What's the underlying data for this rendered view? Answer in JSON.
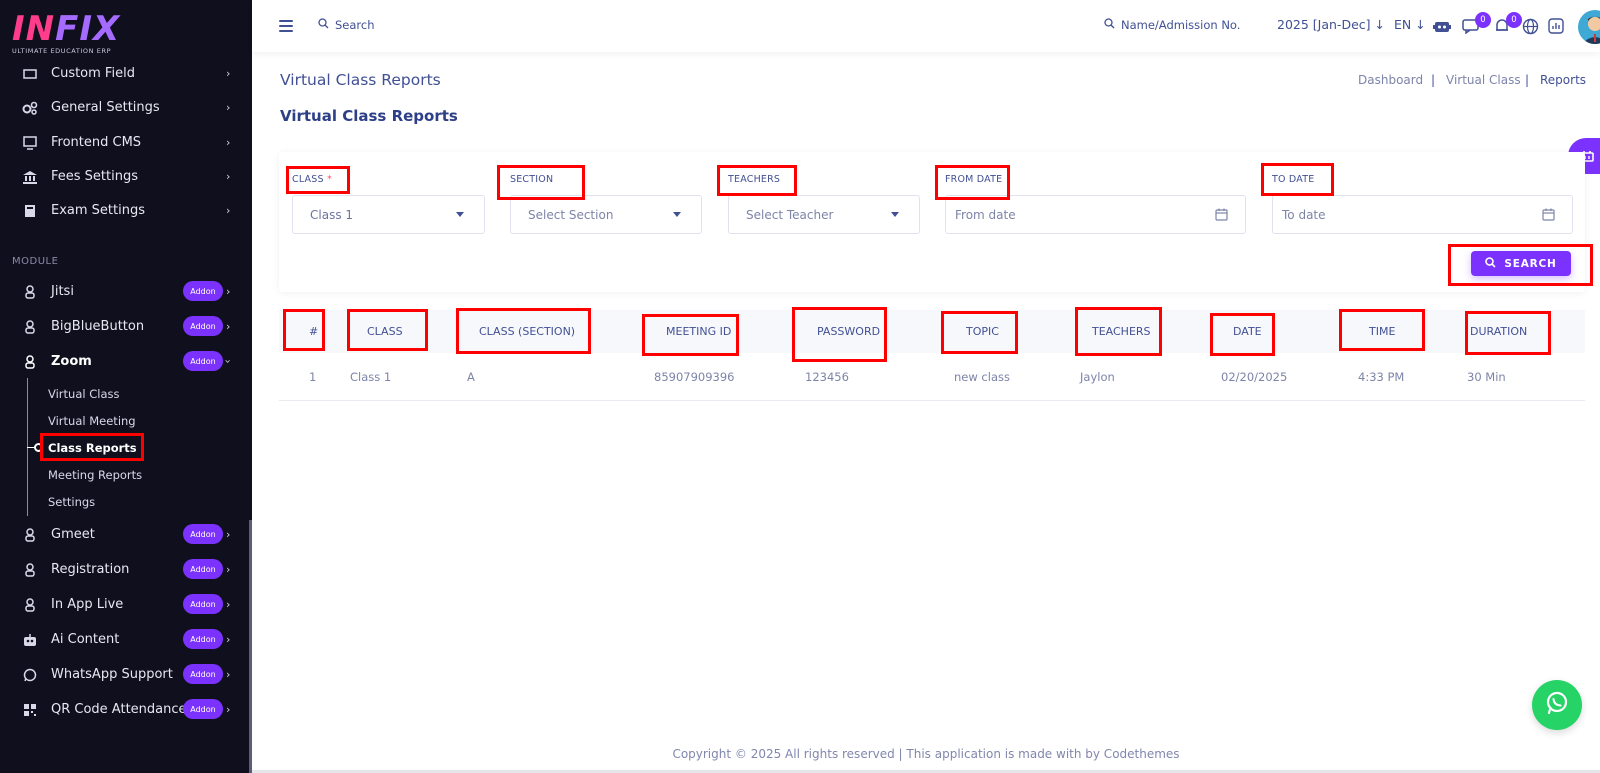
{
  "sidebar": {
    "logo_text_a": "IN",
    "logo_text_b": "FIX",
    "logo_tagline": "ULTIMATE EDUCATION ERP",
    "items_top": [
      {
        "label": "Custom Field"
      },
      {
        "label": "General Settings"
      },
      {
        "label": "Frontend CMS"
      },
      {
        "label": "Fees Settings"
      },
      {
        "label": "Exam Settings"
      }
    ],
    "module_label": "MODULE",
    "modules": [
      {
        "label": "Jitsi",
        "addon": "Addon"
      },
      {
        "label": "BigBlueButton",
        "addon": "Addon"
      },
      {
        "label": "Zoom",
        "addon": "Addon"
      },
      {
        "label": "Gmeet",
        "addon": "Addon"
      },
      {
        "label": "Registration",
        "addon": "Addon"
      },
      {
        "label": "In App Live",
        "addon": "Addon"
      },
      {
        "label": "Ai Content",
        "addon": "Addon"
      },
      {
        "label": "WhatsApp Support",
        "addon": "Addon"
      },
      {
        "label": "QR Code Attendance",
        "addon": "Addon"
      }
    ],
    "zoom_sub": [
      {
        "label": "Virtual Class"
      },
      {
        "label": "Virtual Meeting"
      },
      {
        "label": "Class Reports"
      },
      {
        "label": "Meeting Reports"
      },
      {
        "label": "Settings"
      }
    ]
  },
  "header": {
    "search_label": "Search",
    "student_search_label": "Name/Admission No.",
    "session": "2025 [Jan-Dec]",
    "language": "EN",
    "messages_count": "0",
    "notifications_count": "0"
  },
  "page": {
    "title": "Virtual Class Reports",
    "breadcrumb": [
      "Dashboard",
      "Virtual Class",
      "Reports"
    ],
    "section_title": "Virtual Class Reports"
  },
  "filters": {
    "class_label": "CLASS",
    "class_required": "*",
    "class_value": "Class 1",
    "section_label": "SECTION",
    "section_placeholder": "Select Section",
    "teachers_label": "TEACHERS",
    "teachers_placeholder": "Select Teacher",
    "from_date_label": "FROM DATE",
    "from_date_placeholder": "From date",
    "to_date_label": "TO DATE",
    "to_date_placeholder": "To date",
    "search_button": "SEARCH"
  },
  "table": {
    "columns": [
      "#",
      "CLASS",
      "CLASS (SECTION)",
      "MEETING ID",
      "PASSWORD",
      "TOPIC",
      "TEACHERS",
      "DATE",
      "TIME",
      "DURATION"
    ],
    "rows": [
      [
        "1",
        "Class 1",
        "A",
        "85907909396",
        "123456",
        "new class",
        "Jaylon",
        "02/20/2025",
        "4:33 PM",
        "30 Min"
      ]
    ]
  },
  "footer": {
    "text": "Copyright © 2025 All rights reserved | This application is made with by Codethemes"
  },
  "colors": {
    "accent": "#7c32ff",
    "sidebar_bg": "#0f0f1e",
    "text_primary": "#415094",
    "highlight_box": "#ff0000",
    "whatsapp": "#25d366"
  }
}
